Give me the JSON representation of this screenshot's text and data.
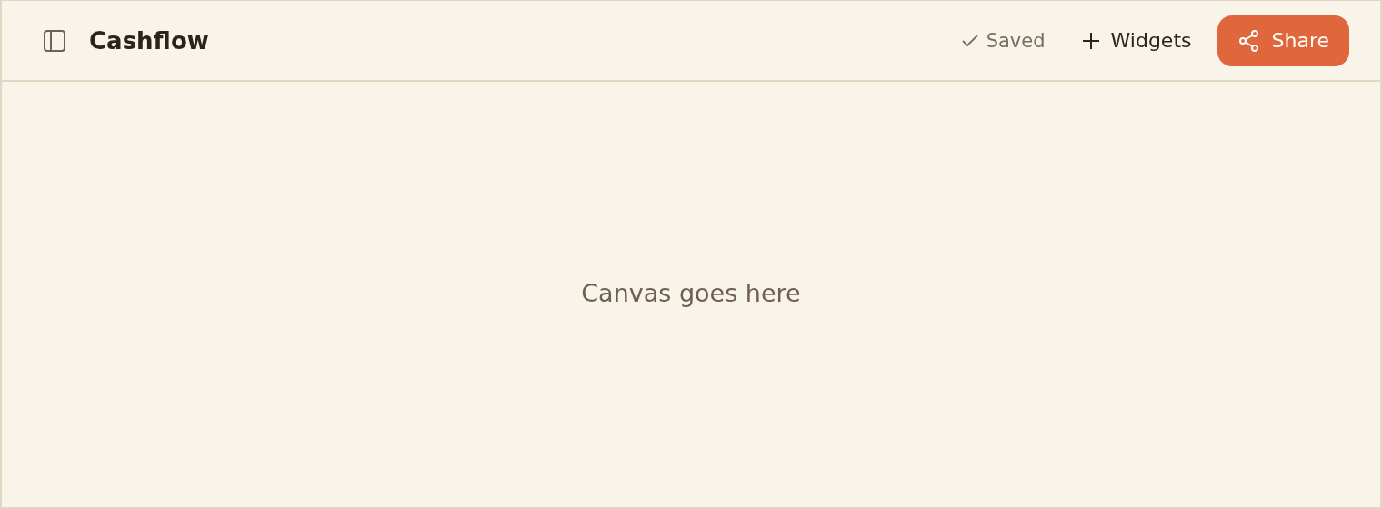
{
  "header": {
    "title": "Cashflow",
    "save_status": "Saved",
    "widgets_button": "Widgets",
    "share_button": "Share"
  },
  "canvas": {
    "message": "Canvas goes here"
  }
}
